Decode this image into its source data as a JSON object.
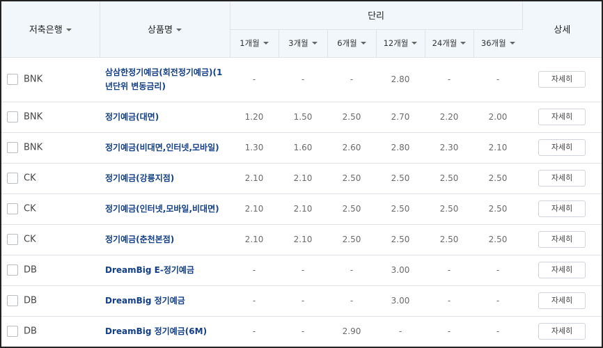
{
  "table": {
    "headers": {
      "bank": "저축은행",
      "product": "상품명",
      "rate_group": "단리",
      "detail": "상세",
      "periods": [
        "1개월",
        "3개월",
        "6개월",
        "12개월",
        "24개월",
        "36개월"
      ]
    },
    "detail_button_label": "자세히",
    "rows": [
      {
        "bank": "BNK",
        "product": "삼삼한정기예금(회전정기예금)(1년단위 변동금리)",
        "rates": [
          "-",
          "-",
          "-",
          "2.80",
          "-",
          "-"
        ]
      },
      {
        "bank": "BNK",
        "product": "정기예금(대면)",
        "rates": [
          "1.20",
          "1.50",
          "2.50",
          "2.70",
          "2.20",
          "2.00"
        ]
      },
      {
        "bank": "BNK",
        "product": "정기예금(비대면,인터넷,모바일)",
        "rates": [
          "1.30",
          "1.60",
          "2.60",
          "2.80",
          "2.30",
          "2.10"
        ]
      },
      {
        "bank": "CK",
        "product": "정기예금(강릉지점)",
        "rates": [
          "2.10",
          "2.10",
          "2.50",
          "2.50",
          "2.50",
          "2.50"
        ]
      },
      {
        "bank": "CK",
        "product": "정기예금(인터넷,모바일,비대면)",
        "rates": [
          "2.10",
          "2.10",
          "2.50",
          "2.50",
          "2.50",
          "2.50"
        ]
      },
      {
        "bank": "CK",
        "product": "정기예금(춘천본점)",
        "rates": [
          "2.10",
          "2.10",
          "2.50",
          "2.50",
          "2.50",
          "2.50"
        ]
      },
      {
        "bank": "DB",
        "product": "DreamBig E-정기예금",
        "rates": [
          "-",
          "-",
          "-",
          "3.00",
          "-",
          "-"
        ]
      },
      {
        "bank": "DB",
        "product": "DreamBig 정기예금",
        "rates": [
          "-",
          "-",
          "-",
          "3.00",
          "-",
          "-"
        ]
      },
      {
        "bank": "DB",
        "product": "DreamBig 정기예금(6M)",
        "rates": [
          "-",
          "-",
          "2.90",
          "-",
          "-",
          "-"
        ]
      }
    ]
  }
}
